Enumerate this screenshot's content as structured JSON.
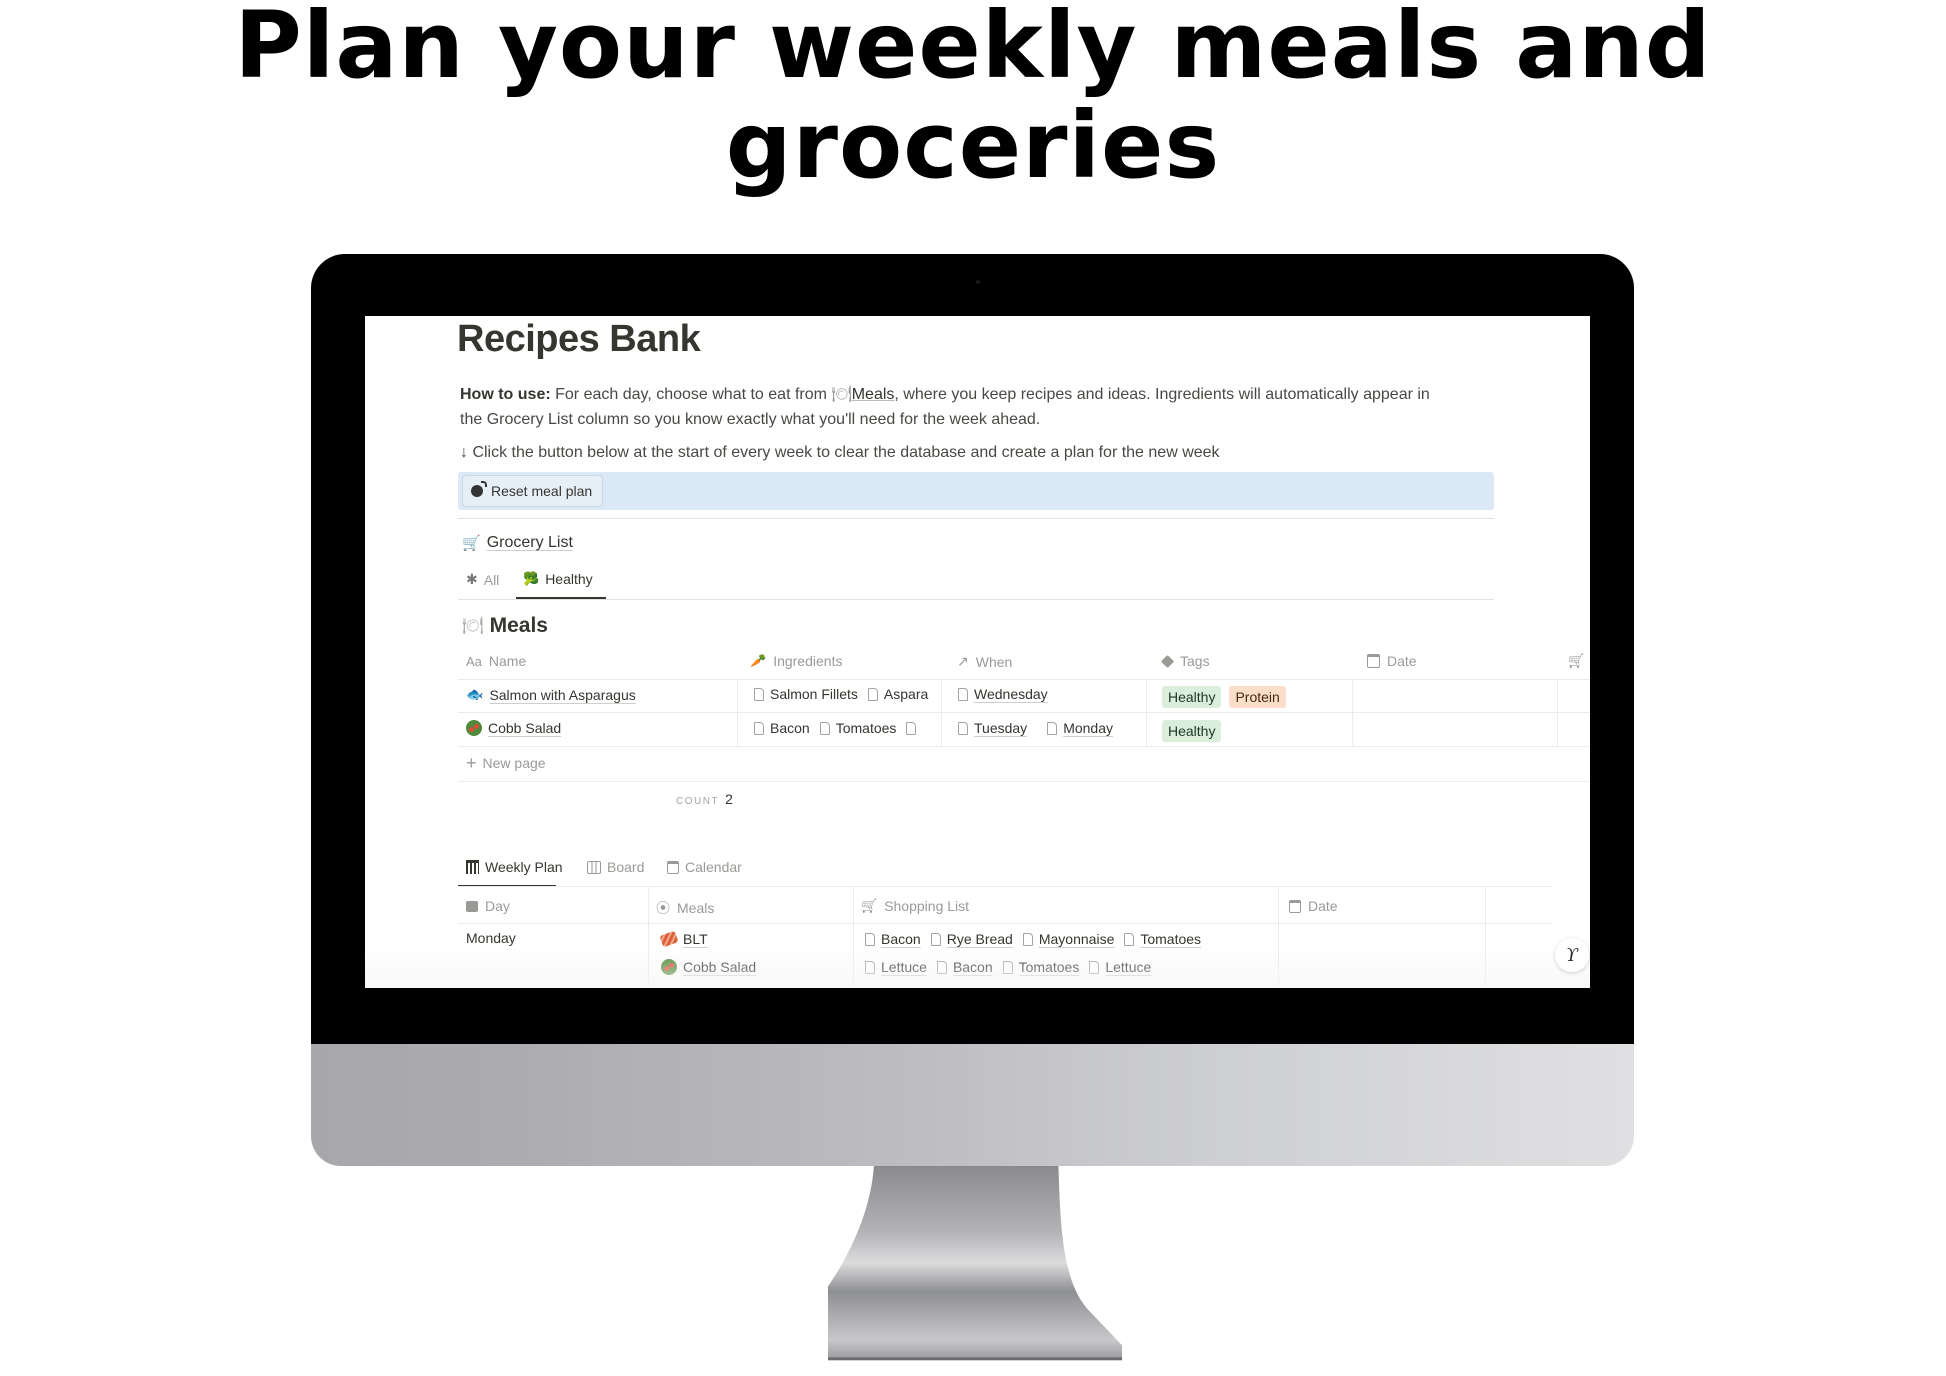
{
  "headline": "Plan your weekly meals and groceries",
  "page": {
    "title": "Recipes Bank",
    "how_to_use_label": "How to use:",
    "how_to_use_text_1": " For each day, choose what to eat from ",
    "meals_link": "Meals",
    "how_to_use_text_2": ", where you keep recipes and ideas. Ingredients will automatically appear in",
    "how_to_use_line2": "the Grocery List column so you know exactly what you'll need for the week ahead.",
    "instruction": "↓ Click the button below at the start of every week to clear the database and create a plan for the new week",
    "reset_button": "Reset meal plan",
    "grocery_list_link": "Grocery List",
    "grocery_tabs": [
      {
        "label": "All",
        "icon": "asterisk-icon",
        "active": false
      },
      {
        "label": "Healthy",
        "icon": "broccoli-icon",
        "active": true
      }
    ]
  },
  "meals_db": {
    "title": "Meals",
    "columns": [
      {
        "label": "Name",
        "icon": "Aa"
      },
      {
        "label": "Ingredients",
        "icon": "carrot-icon"
      },
      {
        "label": "When",
        "icon": "relation-arrow-icon"
      },
      {
        "label": "Tags",
        "icon": "tag-icon"
      },
      {
        "label": "Date",
        "icon": "calendar-icon"
      },
      {
        "label": "",
        "icon": "cart-icon"
      }
    ],
    "rows": [
      {
        "name": "Salmon with Asparagus",
        "emoji": "fish",
        "ingredients": [
          "Salmon Fillets",
          "Aspara"
        ],
        "when": [
          "Wednesday"
        ],
        "tags": [
          {
            "label": "Healthy",
            "color": "green"
          },
          {
            "label": "Protein",
            "color": "orange"
          }
        ],
        "date": ""
      },
      {
        "name": "Cobb Salad",
        "emoji": "salad",
        "ingredients": [
          "Bacon",
          "Tomatoes",
          ""
        ],
        "when": [
          "Tuesday",
          "Monday"
        ],
        "tags": [
          {
            "label": "Healthy",
            "color": "green"
          }
        ],
        "date": ""
      }
    ],
    "new_page": "New page",
    "count_label": "COUNT",
    "count_value": "2"
  },
  "weekly_plan": {
    "views": [
      {
        "label": "Weekly Plan",
        "icon": "calendar-grid-icon",
        "active": true
      },
      {
        "label": "Board",
        "icon": "board-icon",
        "active": false
      },
      {
        "label": "Calendar",
        "icon": "calendar-icon",
        "active": false
      }
    ],
    "columns": [
      {
        "label": "Day",
        "icon": "calendar-page-icon"
      },
      {
        "label": "Meals",
        "icon": "fork-plate-icon"
      },
      {
        "label": "Shopping List",
        "icon": "cart-icon"
      },
      {
        "label": "Date",
        "icon": "calendar-icon"
      }
    ],
    "rows": [
      {
        "day": "Monday",
        "meals": [
          {
            "name": "BLT",
            "emoji": "bacon"
          },
          {
            "name": "Cobb Salad",
            "emoji": "salad"
          }
        ],
        "shopping_line1": [
          "Bacon",
          "Rye Bread",
          "Mayonnaise",
          "Tomatoes"
        ],
        "shopping_line2": [
          "Lettuce",
          "Bacon",
          "Tomatoes",
          "Lettuce"
        ],
        "date": ""
      }
    ]
  },
  "colors": {
    "tag_green_bg": "#dbeddb",
    "tag_orange_bg": "#fadec9",
    "callout_bg": "#dbe9f7"
  }
}
